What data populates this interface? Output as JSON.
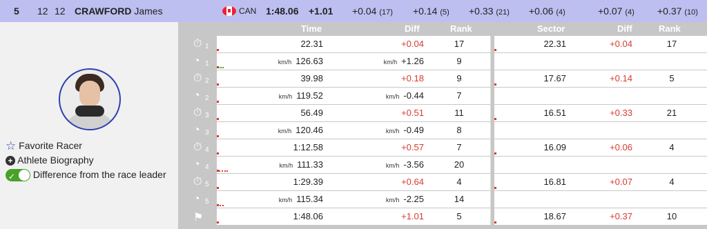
{
  "header": {
    "rank": "5",
    "bib": "12",
    "start_no": "12",
    "last_name": "CRAWFORD",
    "first_name": "James",
    "country": "CAN",
    "total_time": "1:48.06",
    "total_diff": "+1.01",
    "splits": [
      {
        "diff": "+0.04",
        "rank": "(17)"
      },
      {
        "diff": "+0.14",
        "rank": "(5)"
      },
      {
        "diff": "+0.33",
        "rank": "(21)"
      },
      {
        "diff": "+0.06",
        "rank": "(4)"
      },
      {
        "diff": "+0.07",
        "rank": "(4)"
      },
      {
        "diff": "+0.37",
        "rank": "(10)"
      }
    ]
  },
  "options": {
    "favorite": "Favorite Racer",
    "biography": "Athlete Biography",
    "difference": "Difference from the race leader"
  },
  "columns": {
    "time": "Time",
    "diff": "Diff",
    "rank": "Rank",
    "sector": "Sector",
    "sector_diff": "Diff",
    "sector_rank": "Rank"
  },
  "unit": "km/h",
  "rows": [
    {
      "icon": "stopwatch",
      "sub": "1",
      "time": "22.31",
      "diff": "+0.04",
      "rank": "17",
      "sector": "22.31",
      "sdiff": "+0.04",
      "srank": "17"
    },
    {
      "icon": "speed",
      "sub": "1",
      "time": "126.63",
      "diff": "+1.26",
      "rank": "9",
      "sector": "",
      "sdiff": "",
      "srank": ""
    },
    {
      "icon": "stopwatch",
      "sub": "2",
      "time": "39.98",
      "diff": "+0.18",
      "rank": "9",
      "sector": "17.67",
      "sdiff": "+0.14",
      "srank": "5"
    },
    {
      "icon": "speed",
      "sub": "2",
      "time": "119.52",
      "diff": "-0.44",
      "rank": "7",
      "sector": "",
      "sdiff": "",
      "srank": ""
    },
    {
      "icon": "stopwatch",
      "sub": "3",
      "time": "56.49",
      "diff": "+0.51",
      "rank": "11",
      "sector": "16.51",
      "sdiff": "+0.33",
      "srank": "21"
    },
    {
      "icon": "speed",
      "sub": "3",
      "time": "120.46",
      "diff": "-0.49",
      "rank": "8",
      "sector": "",
      "sdiff": "",
      "srank": ""
    },
    {
      "icon": "stopwatch",
      "sub": "4",
      "time": "1:12.58",
      "diff": "+0.57",
      "rank": "7",
      "sector": "16.09",
      "sdiff": "+0.06",
      "srank": "4"
    },
    {
      "icon": "speed",
      "sub": "4",
      "time": "111.33",
      "diff": "-3.56",
      "rank": "20",
      "sector": "",
      "sdiff": "",
      "srank": ""
    },
    {
      "icon": "stopwatch",
      "sub": "5",
      "time": "1:29.39",
      "diff": "+0.64",
      "rank": "4",
      "sector": "16.81",
      "sdiff": "+0.07",
      "srank": "4"
    },
    {
      "icon": "speed",
      "sub": "5",
      "time": "115.34",
      "diff": "-2.25",
      "rank": "14",
      "sector": "",
      "sdiff": "",
      "srank": ""
    },
    {
      "icon": "finish-flag",
      "sub": "",
      "time": "1:48.06",
      "diff": "+1.01",
      "rank": "5",
      "sector": "18.67",
      "sdiff": "+0.37",
      "srank": "10"
    }
  ]
}
